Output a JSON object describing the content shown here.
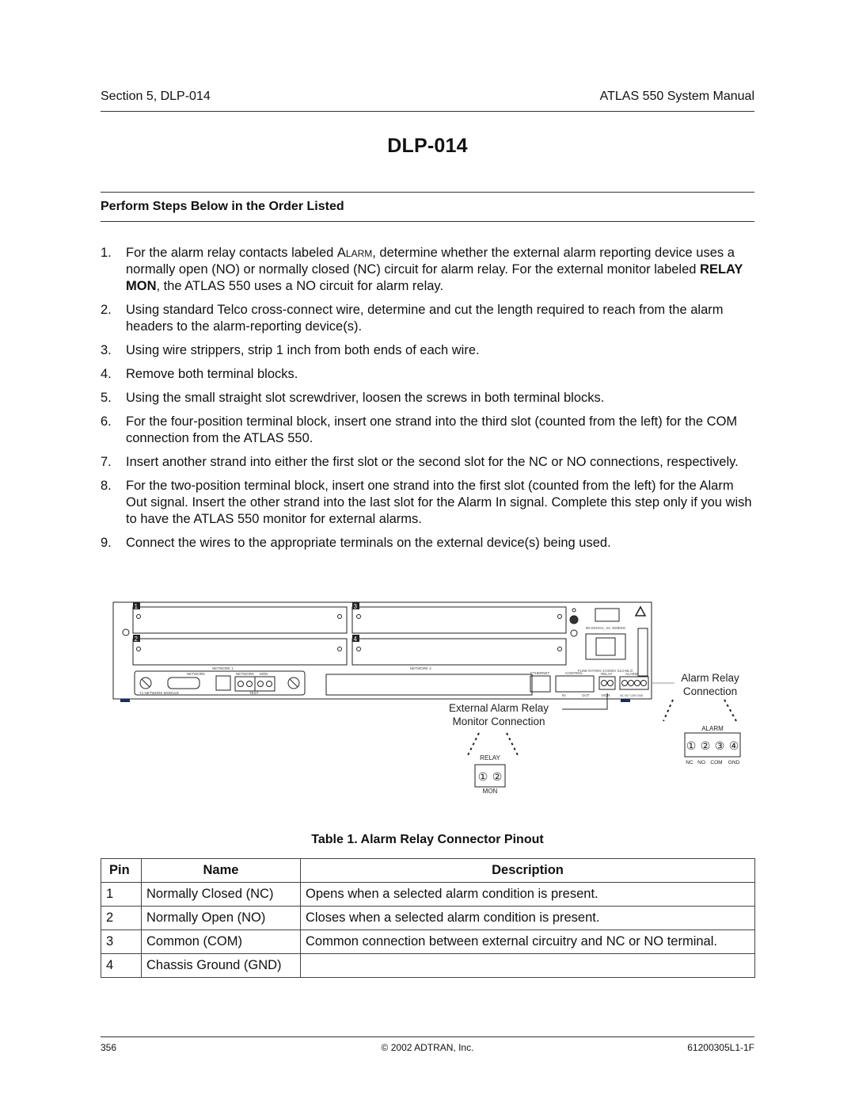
{
  "header": {
    "section": "Section 5, DLP-014",
    "manual": "ATLAS 550 System Manual"
  },
  "title": "DLP-014",
  "subheading": "Perform Steps Below in the Order Listed",
  "steps": [
    {
      "num": "1.",
      "parts": {
        "a": "For the alarm relay contacts labeled ",
        "b": "Alarm",
        "c": ", determine whether the external alarm reporting device uses a normally open (NO) or normally closed (NC) circuit for alarm relay. For the external monitor labeled ",
        "d": "RELAY MON",
        "e": ", the ATLAS 550 uses a NO circuit for alarm relay."
      }
    },
    {
      "num": "2.",
      "text": "Using standard Telco cross-connect wire, determine and cut the length required to reach from the alarm headers to the alarm-reporting device(s)."
    },
    {
      "num": "3.",
      "text": "Using wire strippers, strip 1 inch from both ends of each wire."
    },
    {
      "num": "4.",
      "text": "Remove both terminal blocks."
    },
    {
      "num": "5.",
      "text": "Using the small straight slot screwdriver, loosen the screws in both terminal blocks."
    },
    {
      "num": "6.",
      "text": "For the four-position terminal block, insert one strand into the third slot (counted from the left) for the COM connection from the ATLAS 550."
    },
    {
      "num": "7.",
      "text": "Insert another strand into either the first slot or the second slot for the NC or NO connections, respectively."
    },
    {
      "num": "8.",
      "text": "For the two-position terminal block, insert one strand into the first slot (counted from the left) for the Alarm Out signal. Insert the other strand into the last slot for the Alarm In signal. Complete this step only if you wish to have the ATLAS 550 monitor for external alarms."
    },
    {
      "num": "9.",
      "text": "Connect the wires to the appropriate terminals on the external device(s) being used."
    }
  ],
  "diagram": {
    "slots": [
      "1",
      "2",
      "3",
      "4"
    ],
    "network1_label": "NETWORK 1",
    "network2_label": "NETWORK 2",
    "network_connector_label": "NETWORK",
    "test_network_label": "NETWORK",
    "test_mon_label": "MON",
    "test_label": "TEST",
    "t1_module_label": "T1 NETWORK MODULE",
    "power_rating": "90-240VAC, 2A, 50/60Hz",
    "fuse_rating": "FUSE RATING 2A/250V SLO-BLO",
    "ethernet_label": "ETHERNET",
    "control_label": "CONTROL",
    "control_in": "IN",
    "control_out": "OUT",
    "relay_label": "RELAY",
    "mon_label": "MON",
    "alarm_label": "ALARM",
    "alarm_pins_small": "NC NO COM GND",
    "callout_alarm_relay_line1": "Alarm Relay",
    "callout_alarm_relay_line2": "Connection",
    "callout_ext_line1": "External Alarm Relay",
    "callout_ext_line2": "Monitor Connection",
    "detail_alarm_title": "ALARM",
    "detail_alarm_pins": [
      "①",
      "②",
      "③",
      "④"
    ],
    "detail_alarm_pin_labels": [
      "NC",
      "NO",
      "COM",
      "GND"
    ],
    "detail_relay_title": "RELAY",
    "detail_relay_pins": [
      "①",
      "②"
    ],
    "detail_relay_bottom": "MON"
  },
  "table": {
    "caption": "Table 1.  Alarm Relay Connector Pinout",
    "headers": [
      "Pin",
      "Name",
      "Description"
    ],
    "rows": [
      [
        "1",
        "Normally Closed (NC)",
        "Opens when a selected alarm condition is present."
      ],
      [
        "2",
        "Normally Open (NO)",
        "Closes when a selected alarm condition is present."
      ],
      [
        "3",
        "Common (COM)",
        "Common connection between external circuitry and NC or NO terminal."
      ],
      [
        "4",
        "Chassis Ground (GND)",
        ""
      ]
    ]
  },
  "footer": {
    "page": "356",
    "copyright": "© 2002 ADTRAN, Inc.",
    "doc_number": "61200305L1-1F"
  }
}
